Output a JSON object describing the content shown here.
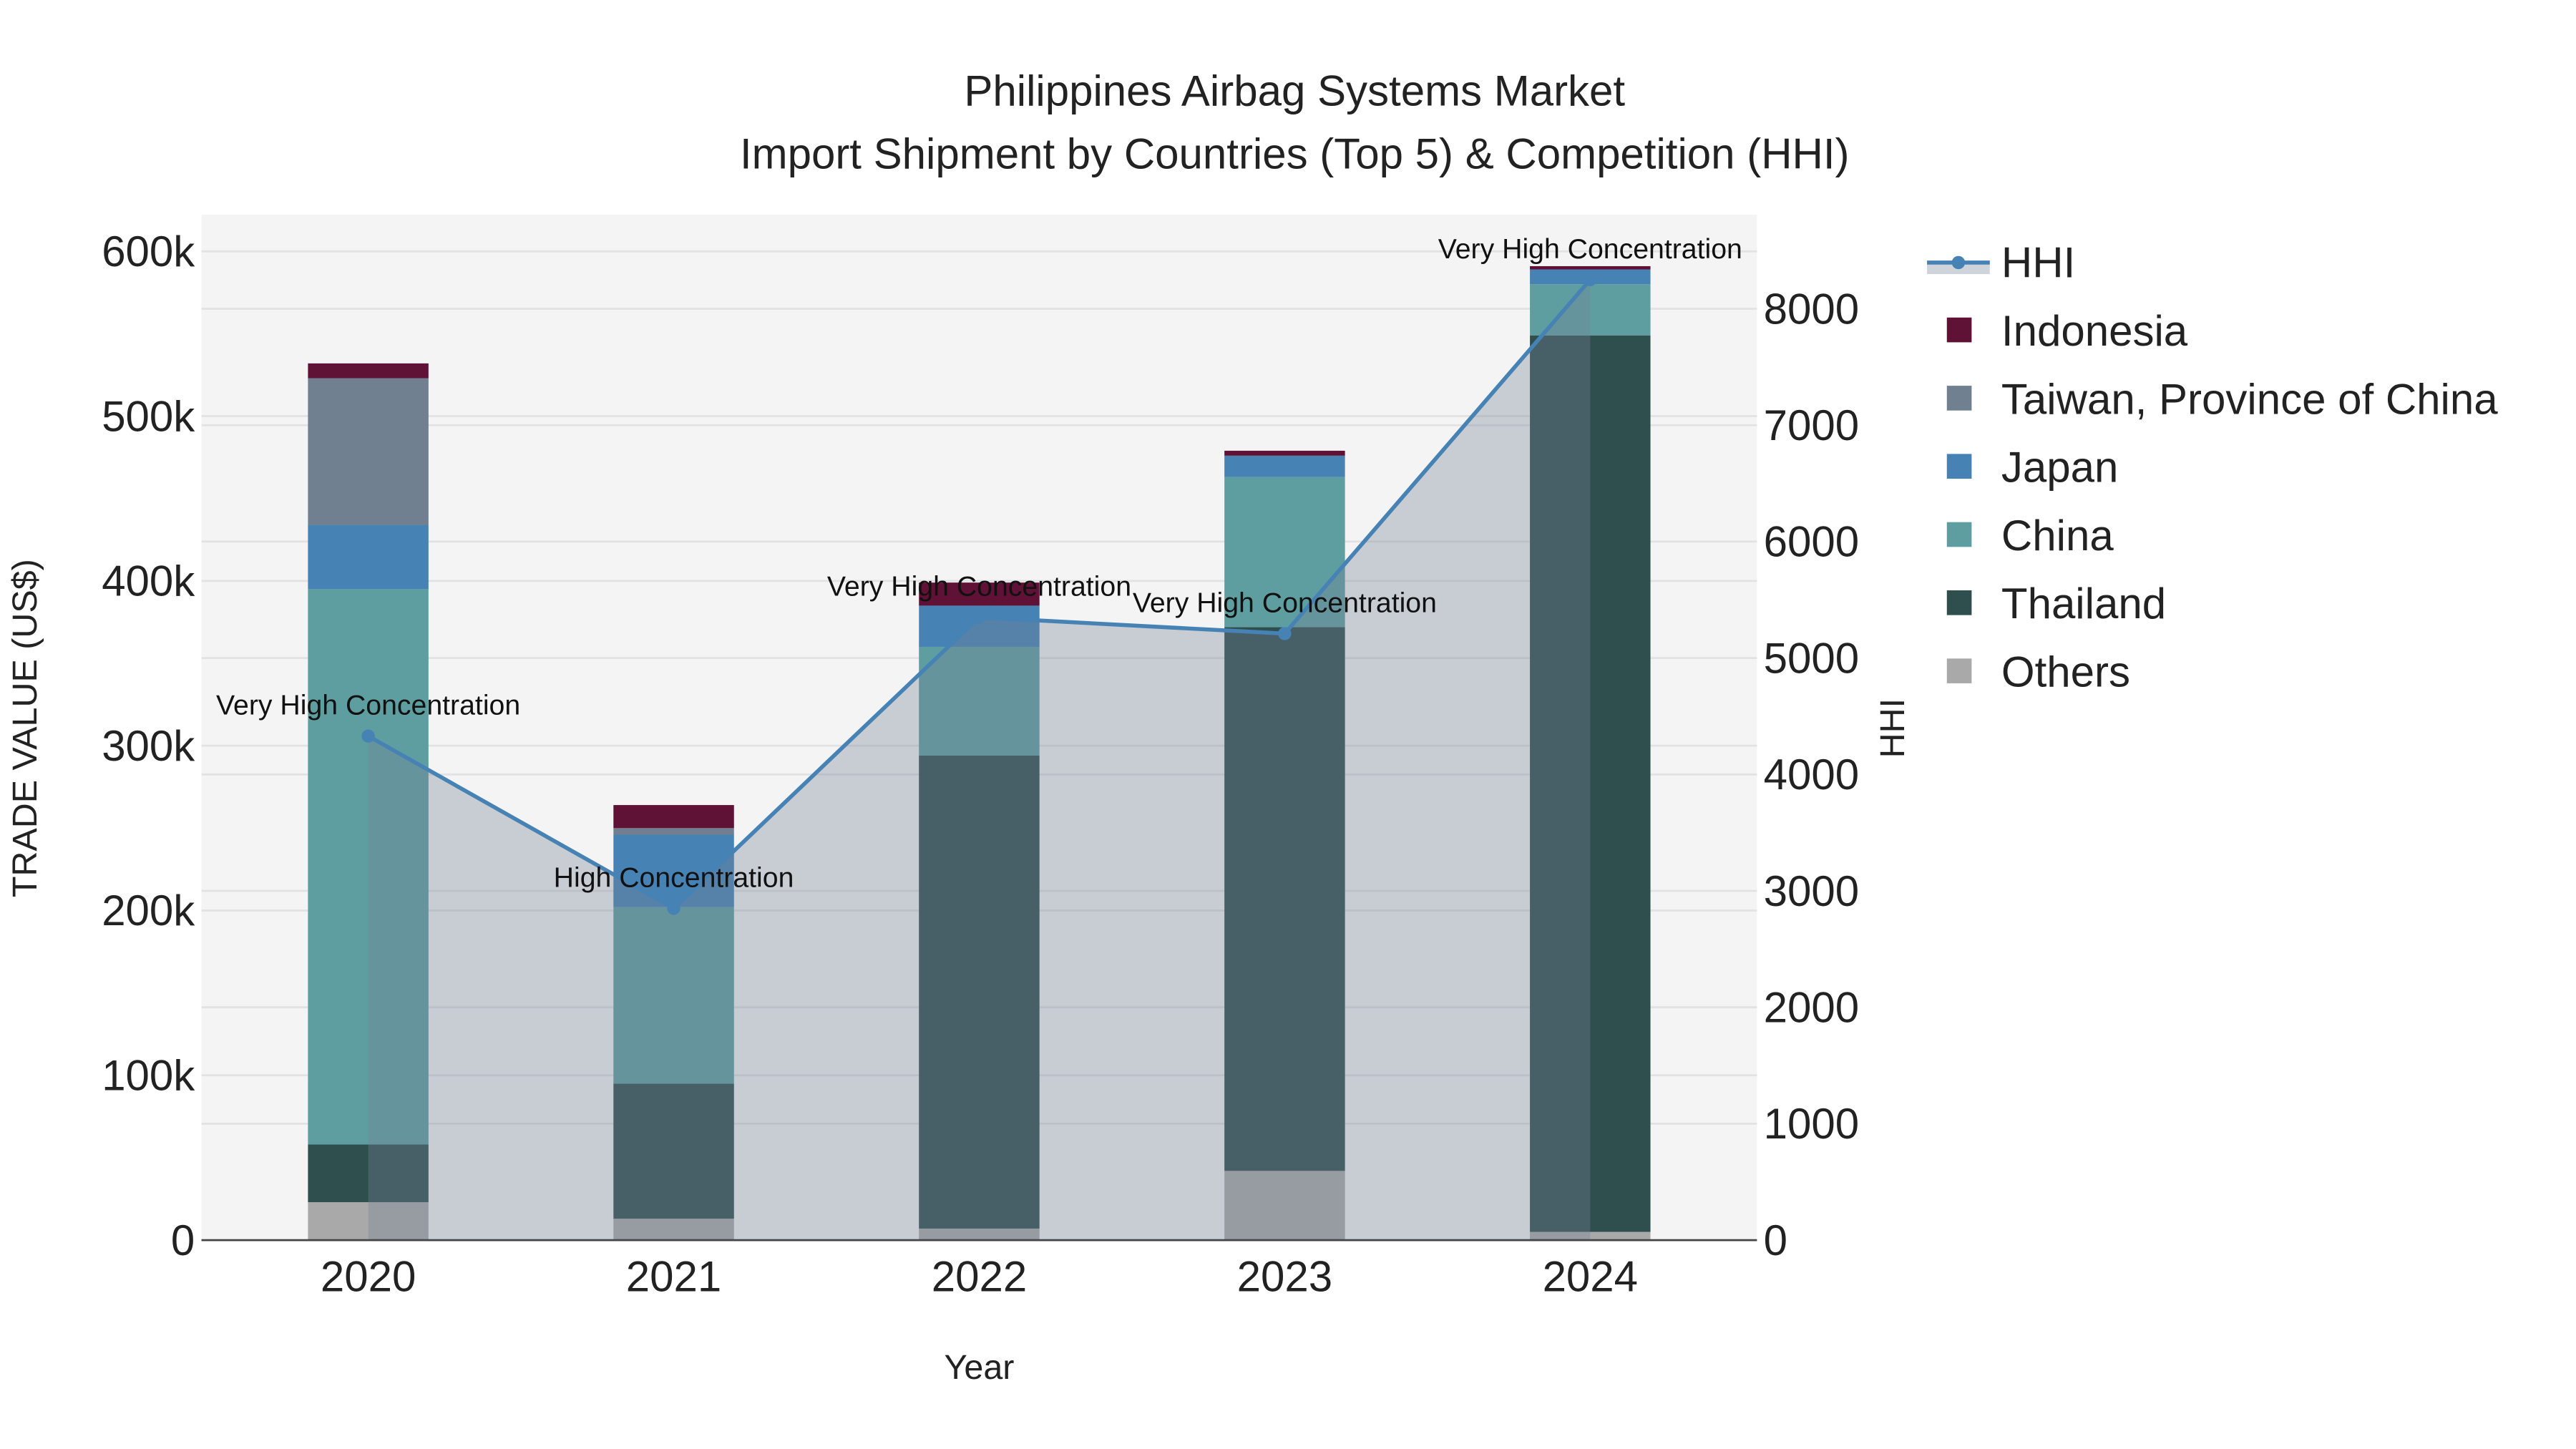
{
  "chart_data": {
    "type": "bar",
    "title": "Philippines Airbag Systems Market",
    "subtitle": "Import Shipment by Countries (Top 5) & Competition (HHI)",
    "xlabel": "Year",
    "ylabel": "TRADE VALUE (US$)",
    "y2label": "HHI",
    "categories": [
      "2020",
      "2021",
      "2022",
      "2023",
      "2024"
    ],
    "ylim": [
      0,
      620000
    ],
    "y2lim": [
      0,
      8800
    ],
    "yticks": [
      0,
      100000,
      200000,
      300000,
      400000,
      500000,
      600000
    ],
    "ytick_labels": [
      "0",
      "100k",
      "200k",
      "300k",
      "400k",
      "500k",
      "600k"
    ],
    "y2ticks": [
      0,
      1000,
      2000,
      3000,
      4000,
      5000,
      6000,
      7000,
      8000
    ],
    "y2tick_labels": [
      "0",
      "1000",
      "2000",
      "3000",
      "4000",
      "5000",
      "6000",
      "7000",
      "8000"
    ],
    "grid": true,
    "legend_position": "right",
    "series": [
      {
        "name": "Others",
        "color": "#a9a9a9",
        "values": [
          23000,
          13000,
          7000,
          42000,
          5000
        ]
      },
      {
        "name": "Thailand",
        "color": "#2f4f4f",
        "values": [
          35000,
          82000,
          287000,
          330000,
          544000
        ]
      },
      {
        "name": "China",
        "color": "#5f9ea0",
        "values": [
          337000,
          107000,
          66000,
          91000,
          31000
        ]
      },
      {
        "name": "Japan",
        "color": "#4682b4",
        "values": [
          39000,
          44000,
          25000,
          13000,
          9000
        ]
      },
      {
        "name": "Taiwan, Province of China",
        "color": "#708090",
        "values": [
          89000,
          4000,
          0,
          0,
          0
        ]
      },
      {
        "name": "Indonesia",
        "color": "#5f1136",
        "values": [
          9000,
          14000,
          14000,
          3000,
          2000
        ]
      }
    ],
    "hhi": {
      "name": "HHI",
      "color": "#4682b4",
      "values": [
        4330,
        2850,
        5350,
        5210,
        8250
      ],
      "annotations": [
        "Very High Concentration",
        "High Concentration",
        "Very High Concentration",
        "Very High Concentration",
        "Very High Concentration"
      ]
    },
    "legend_order": [
      "HHI",
      "Indonesia",
      "Taiwan, Province of China",
      "Japan",
      "China",
      "Thailand",
      "Others"
    ]
  }
}
